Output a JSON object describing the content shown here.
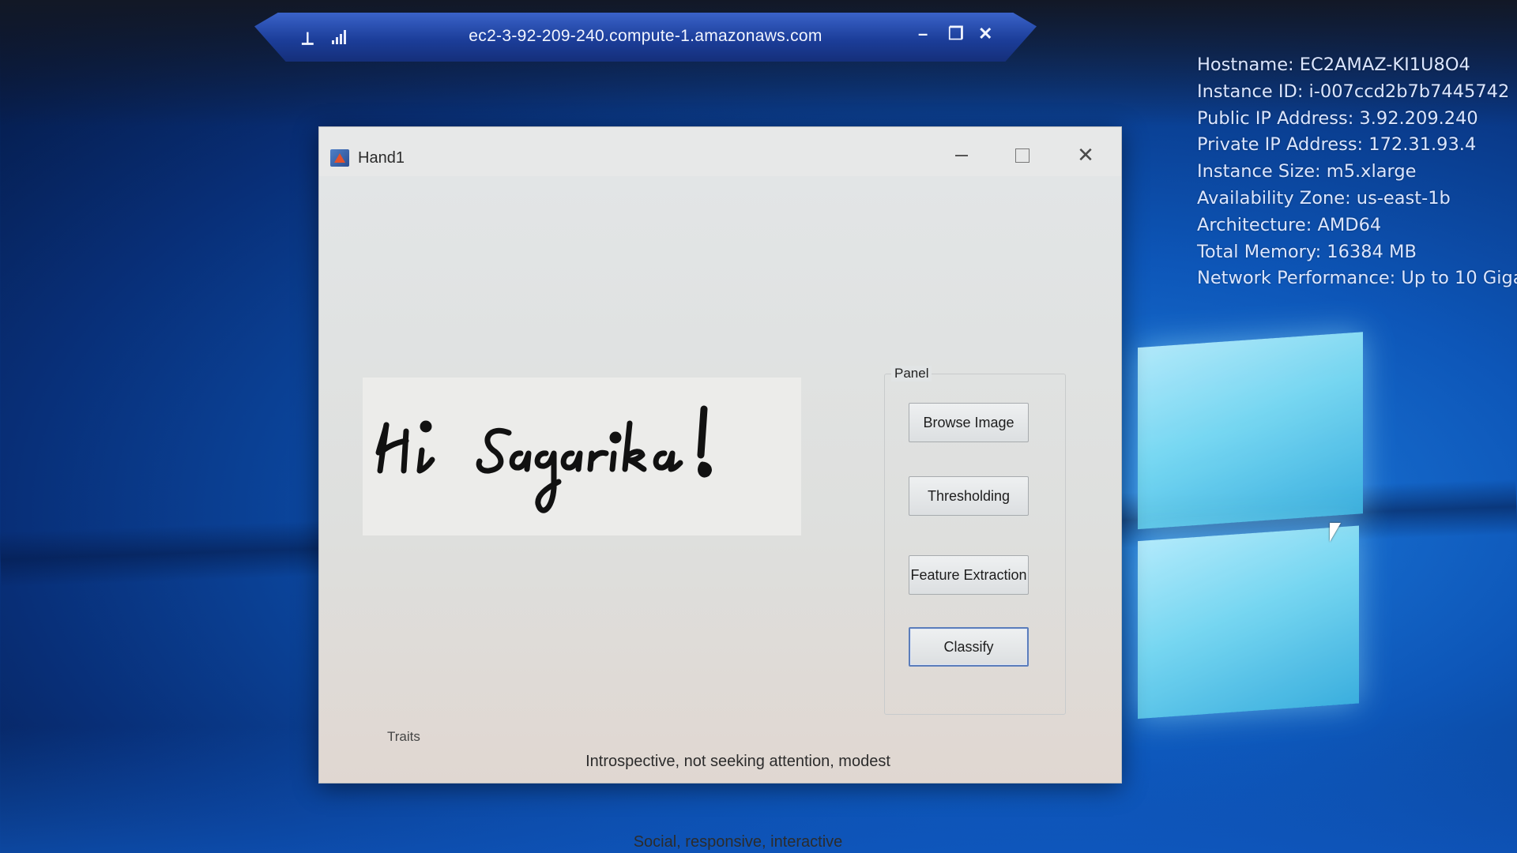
{
  "rdp_bar": {
    "title": "ec2-3-92-209-240.compute-1.amazonaws.com",
    "pin_icon": "pin-icon",
    "signal_icon": "signal-icon",
    "minimize_glyph": "–",
    "restore_glyph": "❐",
    "close_glyph": "✕"
  },
  "instance_info": {
    "hostname": "Hostname: EC2AMAZ-KI1U8O4",
    "instance_id": "Instance ID: i-007ccd2b7b7445742",
    "public_ip": "Public IP Address: 3.92.209.240",
    "private_ip": "Private IP Address: 172.31.93.4",
    "instance_size": "Instance Size: m5.xlarge",
    "availability_zone": "Availability Zone: us-east-1b",
    "architecture": "Architecture: AMD64",
    "total_memory": "Total Memory: 16384 MB",
    "network_performance": "Network Performance: Up to 10 Giga"
  },
  "window": {
    "title": "Hand1",
    "close_glyph": "✕"
  },
  "image": {
    "handwriting_text": "Hi Sagarika!"
  },
  "panel": {
    "legend": "Panel",
    "browse_label": "Browse Image",
    "threshold_label": "Thresholding",
    "feature_label": "Feature Extraction",
    "classify_label": "Classify"
  },
  "traits": {
    "label": "Traits",
    "result_1": "Introspective, not seeking attention, modest",
    "result_2": "Social, responsive, interactive"
  }
}
